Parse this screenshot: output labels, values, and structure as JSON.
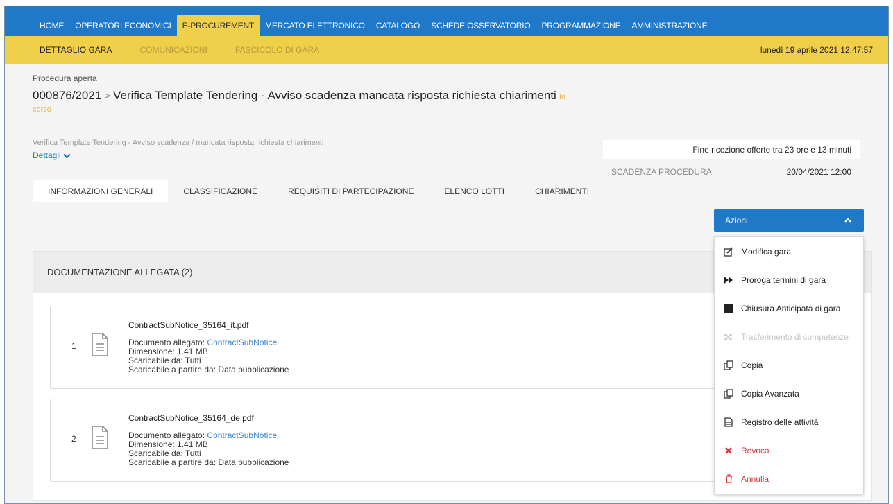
{
  "topnav": {
    "items": [
      {
        "label": "HOME"
      },
      {
        "label": "OPERATORI ECONOMICI"
      },
      {
        "label": "E-PROCUREMENT"
      },
      {
        "label": "MERCATO ELETTRONICO"
      },
      {
        "label": "CATALOGO"
      },
      {
        "label": "SCHEDE OSSERVATORIO"
      },
      {
        "label": "PROGRAMMAZIONE"
      },
      {
        "label": "AMMINISTRAZIONE"
      }
    ],
    "active_index": 2
  },
  "subnav": {
    "items": [
      {
        "label": "DETTAGLIO GARA"
      },
      {
        "label": "COMUNICAZIONI"
      },
      {
        "label": "FASCICOLO DI GARA"
      }
    ],
    "datetime": "lunedì 19 aprile 2021 12:47:57"
  },
  "header": {
    "procedure_type": "Procedura aperta",
    "code": "000876/2021",
    "title": "Verifica Template Tendering - Avviso scadenza mancata risposta richiesta chiarimenti",
    "status": "In corso",
    "description": "Verifica Template Tendering - Avviso scadenza / mancata risposta richiesta chiarimenti",
    "details_label": "Dettagli"
  },
  "deadline": {
    "countdown": "Fine ricezione offerte tra 23 ore e 13 minuti",
    "label": "SCADENZA PROCEDURA",
    "value": "20/04/2021 12:00"
  },
  "tabs": [
    {
      "label": "INFORMAZIONI GENERALI"
    },
    {
      "label": "CLASSIFICAZIONE"
    },
    {
      "label": "REQUISITI DI PARTECIPAZIONE"
    },
    {
      "label": "ELENCO LOTTI"
    },
    {
      "label": "CHIARIMENTI"
    }
  ],
  "documents": {
    "section_title": "DOCUMENTAZIONE ALLEGATA (2)",
    "items": [
      {
        "num": "1",
        "name": "ContractSubNotice_35164_it.pdf",
        "attached_label": "Documento allegato: ",
        "attached_link": "ContractSubNotice",
        "size": "Dimensione: 1.41 MB",
        "downloadable_by": "Scaricabile da: Tutti",
        "downloadable_from": "Scaricabile a partire da: Data pubblicazione"
      },
      {
        "num": "2",
        "name": "ContractSubNotice_35164_de.pdf",
        "attached_label": "Documento allegato: ",
        "attached_link": "ContractSubNotice",
        "size": "Dimensione: 1.41 MB",
        "downloadable_by": "Scaricabile da: Tutti",
        "downloadable_from": "Scaricabile a partire da: Data pubblicazione"
      }
    ]
  },
  "actions": {
    "button_label": "Azioni",
    "menu": [
      {
        "label": "Modifica gara",
        "icon": "edit-icon"
      },
      {
        "label": "Proroga termini di gara",
        "icon": "fast-forward-icon"
      },
      {
        "label": "Chiusura Anticipata di gara",
        "icon": "stop-icon"
      },
      {
        "label": "Trasferimento di competenze",
        "icon": "shuffle-icon"
      },
      {
        "label": "Copia",
        "icon": "copy-icon"
      },
      {
        "label": "Copia Avanzata",
        "icon": "copy-icon"
      },
      {
        "label": "Registro delle attività",
        "icon": "file-text-icon"
      },
      {
        "label": "Revoca",
        "icon": "times-icon"
      },
      {
        "label": "Annulla",
        "icon": "trash-icon"
      }
    ]
  },
  "colors": {
    "primary": "#1f78c8",
    "accent": "#f0d04a",
    "danger": "#d9363e"
  }
}
